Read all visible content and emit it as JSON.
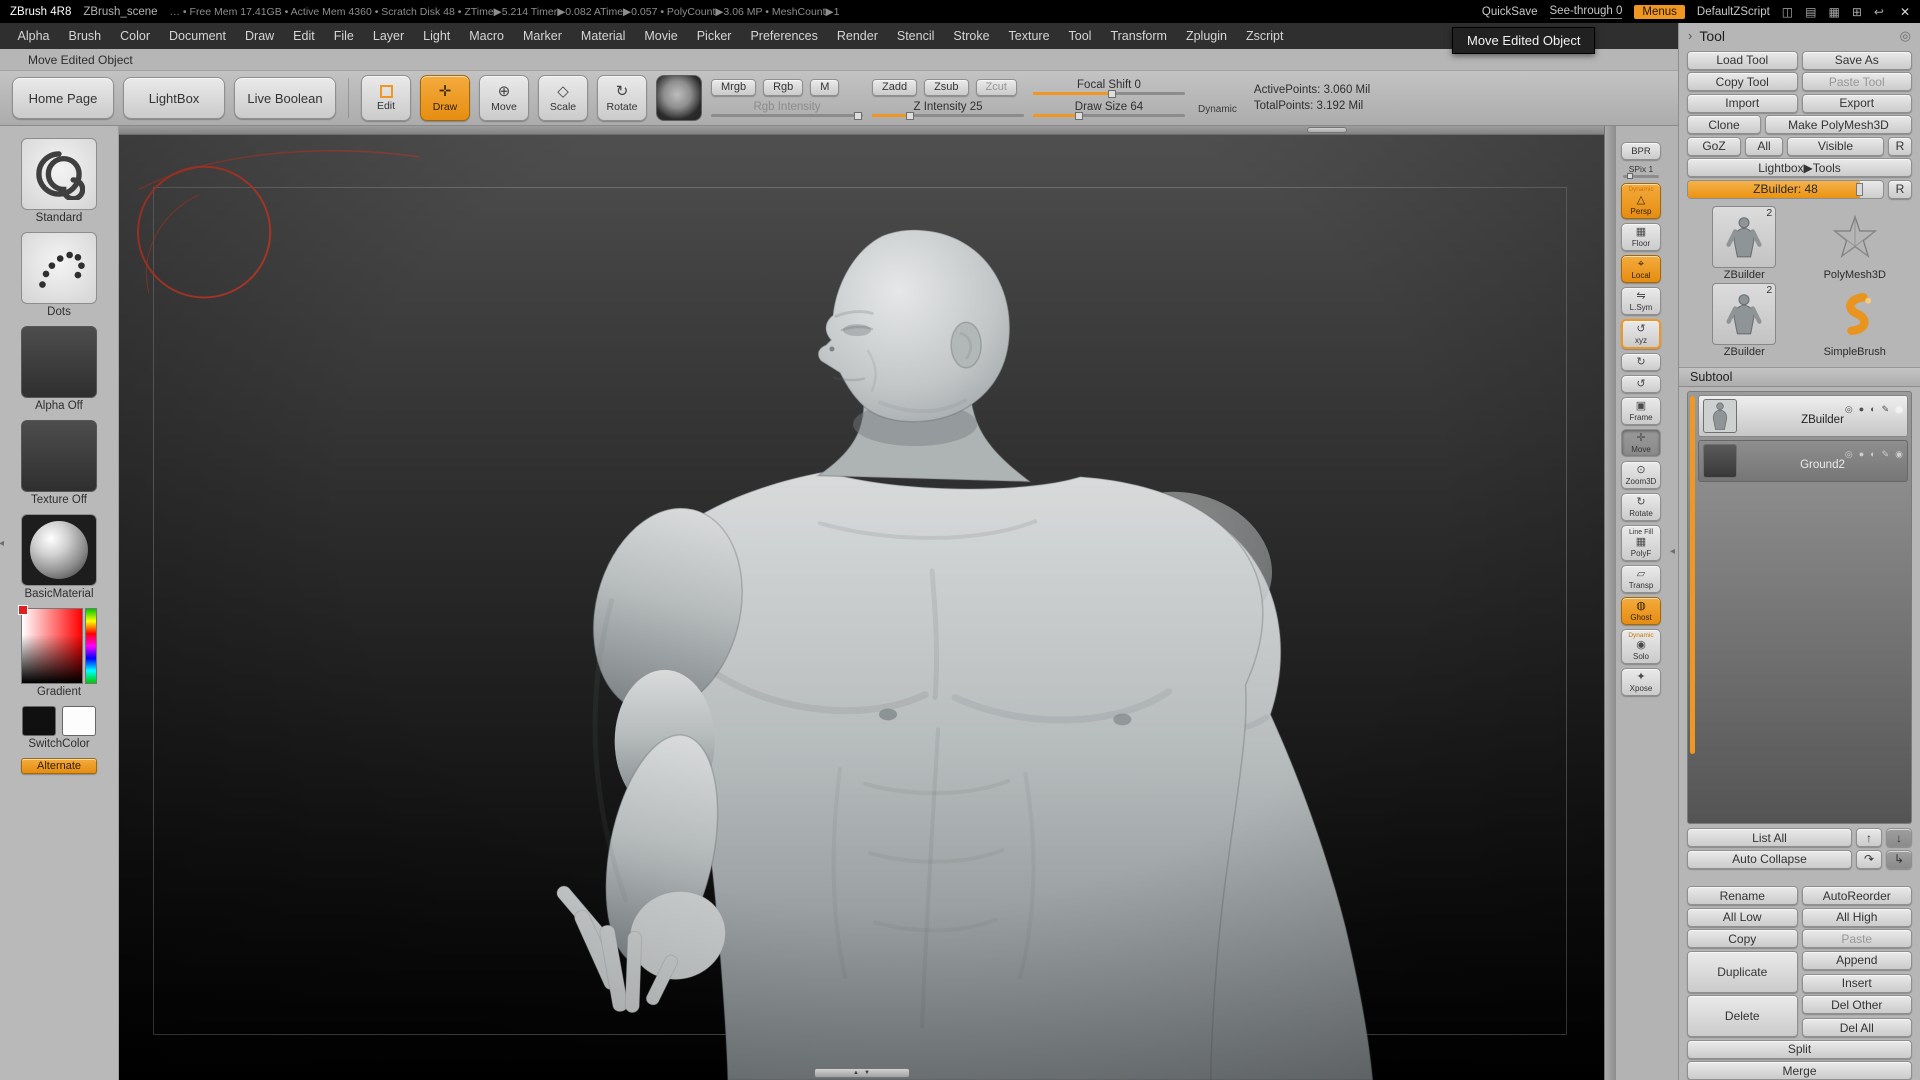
{
  "titlebar": {
    "app_name": "ZBrush 4R8",
    "doc_name": "ZBrush_scene",
    "stats": "… • Free Mem 17.41GB • Active Mem 4360 • Scratch Disk 48 • ZTime▶5.214 Timer▶0.082 ATime▶0.057 • PolyCount▶3.06 MP • MeshCount▶1",
    "quicksave": "QuickSave",
    "see_through": "See-through 0",
    "menus_button": "Menus",
    "zscript_name": "DefaultZScript"
  },
  "menubar": {
    "items": [
      "Alpha",
      "Brush",
      "Color",
      "Document",
      "Draw",
      "Edit",
      "File",
      "Layer",
      "Light",
      "Macro",
      "Marker",
      "Material",
      "Movie",
      "Picker",
      "Preferences",
      "Render",
      "Stencil",
      "Stroke",
      "Texture",
      "Tool",
      "Transform",
      "Zplugin",
      "Zscript"
    ]
  },
  "hint_text": "Move Edited Object",
  "tooltip_text": "Move Edited Object",
  "toolbar": {
    "home_page": "Home Page",
    "lightbox": "LightBox",
    "live_boolean": "Live Boolean",
    "edit": "Edit",
    "draw": "Draw",
    "move": "Move",
    "scale": "Scale",
    "rotate": "Rotate",
    "mrgb": "Mrgb",
    "rgb": "Rgb",
    "m": "M",
    "rgb_intensity": "Rgb Intensity",
    "zadd": "Zadd",
    "zsub": "Zsub",
    "zcut": "Zcut",
    "z_intensity": "Z Intensity 25",
    "focal_shift": "Focal Shift 0",
    "draw_size": "Draw Size 64",
    "dynamic": "Dynamic",
    "active_points": "ActivePoints: 3.060 Mil",
    "total_points": "TotalPoints: 3.192 Mil"
  },
  "left_palette": {
    "brush_label": "Standard",
    "stroke_label": "Dots",
    "alpha_label": "Alpha Off",
    "texture_label": "Texture Off",
    "material_label": "BasicMaterial",
    "gradient_label": "Gradient",
    "switch_label": "SwitchColor",
    "alternate_label": "Alternate"
  },
  "right_shelf": {
    "bpr": "BPR",
    "spix": "SPix 1",
    "dynamic_persp": "Dynamic",
    "persp": "Persp",
    "floor": "Floor",
    "local": "Local",
    "lsym": "L.Sym",
    "xyz": "xyz",
    "frame": "Frame",
    "move": "Move",
    "zoom3d": "Zoom3D",
    "rotate": "Rotate",
    "line_fill": "Line Fill",
    "polyf": "PolyF",
    "transp": "Transp",
    "ghost": "Ghost",
    "dynamic_solo": "Dynamic",
    "solo": "Solo",
    "xpose": "Xpose"
  },
  "tool_panel": {
    "title": "Tool",
    "load_tool": "Load Tool",
    "save_as": "Save As",
    "copy_tool": "Copy Tool",
    "paste_tool": "Paste Tool",
    "import": "Import",
    "export": "Export",
    "clone": "Clone",
    "make_polymesh3d": "Make PolyMesh3D",
    "goz": "GoZ",
    "all": "All",
    "visible": "Visible",
    "r_button": "R",
    "lightbox_tools": "Lightbox▶Tools",
    "active_tool_slider": "ZBuilder: 48",
    "slider_r": "R",
    "thumbnails": [
      {
        "label": "ZBuilder",
        "badge": "2"
      },
      {
        "label": "PolyMesh3D",
        "badge": ""
      },
      {
        "label": "ZBuilder",
        "badge": "2"
      },
      {
        "label": "SimpleBrush",
        "badge": ""
      }
    ],
    "subtool": {
      "title": "Subtool",
      "items": [
        {
          "name": "ZBuilder"
        },
        {
          "name": "Ground2"
        }
      ],
      "list_all": "List All",
      "auto_collapse": "Auto Collapse",
      "rename": "Rename",
      "autoreorder": "AutoReorder",
      "all_low": "All Low",
      "all_high": "All High",
      "copy": "Copy",
      "paste": "Paste",
      "duplicate": "Duplicate",
      "append": "Append",
      "insert": "Insert",
      "delete": "Delete",
      "del_other": "Del Other",
      "del_all": "Del All",
      "split": "Split",
      "merge": "Merge"
    }
  },
  "icons": {
    "close": "✕",
    "window": "◫",
    "panel": "▤",
    "grid": "▦",
    "plus_box": "⊞",
    "back": "↩",
    "chevron": "›",
    "knob": "◎",
    "spin_cw": "↻",
    "spin_ccw": "↺",
    "tri_up": "▲",
    "tri_down": "▼",
    "arrow_up": "↑",
    "arrow_down": "↓",
    "redo": "↷",
    "branch": "↳",
    "dot": "●",
    "half": "◐",
    "pencil": "✎",
    "ring": "◎",
    "eye": "◉",
    "collapse": "◂",
    "cross": "✛",
    "gyro": "⊕",
    "diamond": "◇",
    "rotate": "↻",
    "target": "⊙",
    "para": "▱",
    "ghost_icon": "◍",
    "star": "✦",
    "sym": "⇋",
    "local_target": "⌖",
    "persp_tri": "△",
    "frame_box": "▣"
  },
  "colors": {
    "accent_orange": "#ef9722",
    "canvas_top": "#4f4f4f",
    "canvas_bottom": "#000000"
  }
}
